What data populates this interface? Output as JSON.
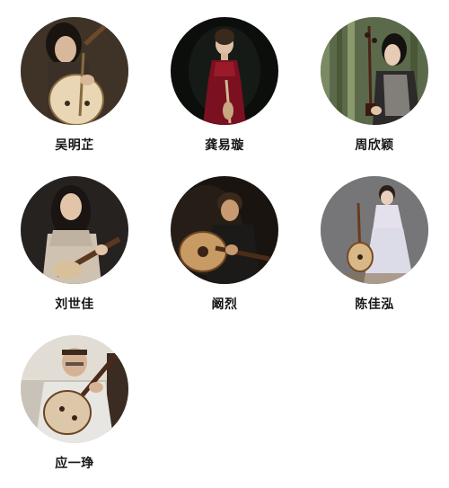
{
  "musicians": [
    {
      "name": "吴明芷",
      "photo": "portrait-with-pipa"
    },
    {
      "name": "龚易璇",
      "photo": "portrait-in-red-dress"
    },
    {
      "name": "周欣颖",
      "photo": "portrait-with-erhu"
    },
    {
      "name": "刘世佳",
      "photo": "portrait-with-liuqin"
    },
    {
      "name": "阚烈",
      "photo": "portrait-with-ruan"
    },
    {
      "name": "陈佳泓",
      "photo": "portrait-with-ruan-white-dress"
    },
    {
      "name": "应一琤",
      "photo": "portrait-with-zhongruan"
    }
  ]
}
